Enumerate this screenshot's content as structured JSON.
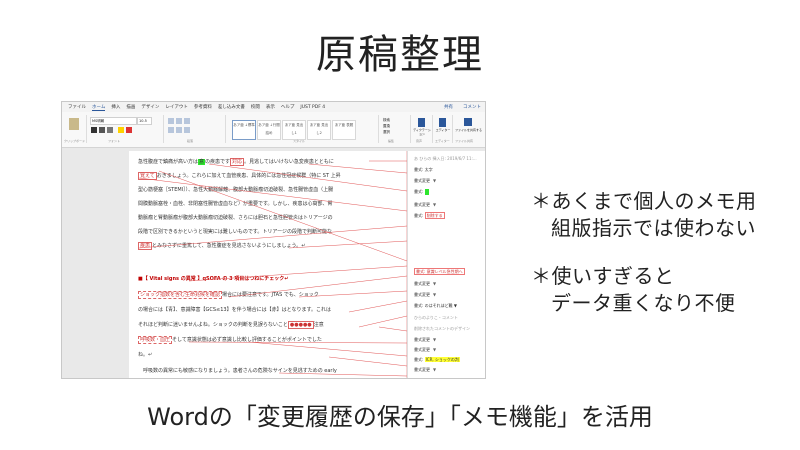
{
  "title": "原稿整理",
  "notes": {
    "note1_line1": "＊あくまで個人のメモ用",
    "note1_line2": "組版指示では使わない",
    "note2_line1": "＊使いすぎると",
    "note2_line2": "データ重くなり不便"
  },
  "caption": "Wordの「変更履歴の保存」「メモ機能」を活用",
  "word": {
    "menu": [
      "ファイル",
      "ホーム",
      "挿入",
      "描画",
      "デザイン",
      "レイアウト",
      "参考資料",
      "差し込み文書",
      "校閲",
      "表示",
      "ヘルプ",
      "JUST PDF 4"
    ],
    "menu_right": [
      "共有",
      "コメント"
    ],
    "font_name": "MS明朝",
    "font_size": "10.5",
    "styles": [
      "あア亜 ↓標準",
      "あア亜 ↓行間詰め",
      "あア亜 見出し1",
      "あア亜 見出し2",
      "あア亜 表題"
    ],
    "group_labels": [
      "クリップボード",
      "フォント",
      "段落",
      "スタイル",
      "編集",
      "音声",
      "エディター",
      "ファイル共有"
    ],
    "right_buttons": [
      "検索",
      "置換",
      "選択",
      "ディクテーション",
      "エディター",
      "ファイルを共有する"
    ],
    "doc_lines": [
      {
        "pre": "急性腹症で鎮痛が高い方は",
        "hl": "意",
        "mid": "の疾患です",
        "box": "対応",
        "post": "。見逃してはいけない急変疾患とともに"
      },
      {
        "box": "覚えて",
        "post": "おきましょう。これらに加えて血管疾患、具体的には急性冠症候群（特に ST 上昇"
      },
      {
        "post": "型心筋梗塞［STEMI］）、急性大動脈解離、腹部大動脈瘤切迫破裂、急性腸管虚血（上腸"
      },
      {
        "post": "間膜動脈塞栓・血栓、非閉塞性腸管虚血など）が重要です。しかし、疾患は心窩部、腎"
      },
      {
        "post": "動脈瘤と腎動脈瘤が腹部大動脈瘤切迫破裂、さらには胆石と急性胆管炎はトリアージの"
      },
      {
        "post": "段階で区別できるかというと現実には難しいものです。トリアージの段階で判断可能な"
      },
      {
        "box": "疾患",
        "post": "とみなさずに重篤して、急性腹症を見逃さないようにしましょう。↵"
      }
    ],
    "heading": "■【 Vital signs の異常 】qSOFA の 3 項目はつねにチェック↵",
    "doc_lines2": [
      {
        "dash": "ショック指数を含む生命兆候を確認",
        "post": "場合には要注意です。JTAS でも、ショック"
      },
      {
        "post": "の場合には【青】、意識障害【GCS≤13】を伴う場合には【赤】はとなります。これは"
      },
      {
        "pre": "それほど判断に迷いませんよね。ショックの判断を見誤らないこと",
        "box": "●●●●●",
        "post": "注意"
      },
      {
        "dash": "呼吸数・血圧",
        "post": "そして意識状態は必ず意識し比較し評価することがポイントでした"
      },
      {
        "post": "ね。↵"
      },
      {
        "post": "　呼吸数の異常にも敏感になりましょう。患者さんの危険なサインを見逃すための early"
      }
    ],
    "pane": [
      {
        "text": "あ ひらの 挿入日: 2019/6/7 11:...",
        "muted": true
      },
      {
        "text": "書式: 太字"
      },
      {
        "label": "書式変更",
        "caret": "▼"
      },
      {
        "text": "書式:",
        "green": true
      },
      {
        "label": "書式変更",
        "caret": "▼"
      },
      {
        "text": "書式:",
        "pink": "削除する"
      },
      {
        "text": "書式: 意識レベル急性期へ",
        "pink2": true
      },
      {
        "label": "書式変更",
        "caret": "▼"
      },
      {
        "label": "書式変更",
        "caret": "▼"
      },
      {
        "text": "書式:  のはそれほど難  ▼"
      },
      {
        "text": "ひらのよりこ・コメント",
        "muted": true
      },
      {
        "text": "削除されたコメントのデザイン",
        "muted": true
      },
      {
        "label": "書式変更",
        "caret": "▼"
      },
      {
        "label": "書式変更",
        "caret": "▼"
      },
      {
        "text": "書式:",
        "yellow": "ICR, ショックの判"
      },
      {
        "label": "書式変更",
        "caret": "▼"
      },
      {
        "text": "書式:　　患さんの危険なサ..."
      }
    ]
  }
}
